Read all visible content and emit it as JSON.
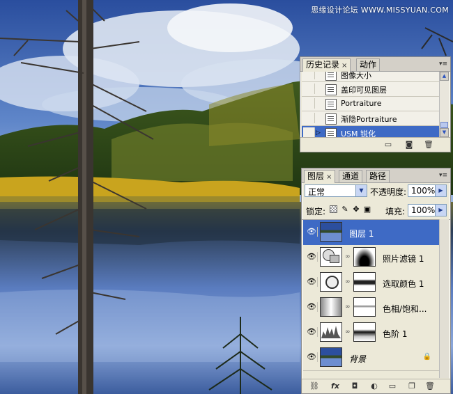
{
  "watermark": "思缘设计论坛 WWW.MISSYUAN.COM",
  "history_panel": {
    "tabs": [
      {
        "label": "历史记录",
        "close": "×",
        "active": true
      },
      {
        "label": "动作",
        "close": "",
        "active": false
      }
    ],
    "menu_icon": "▾≡",
    "items": [
      {
        "label": "图像大小",
        "selected": false,
        "current": false
      },
      {
        "label": "盖印可见图层",
        "selected": false,
        "current": false
      },
      {
        "label": "Portraiture",
        "selected": false,
        "current": false
      },
      {
        "label": "渐隐Portraiture",
        "selected": false,
        "current": false
      },
      {
        "label": "USM 锐化",
        "selected": true,
        "current": true
      }
    ],
    "footer_icons": [
      "new-document-from-state-icon",
      "snapshot-icon",
      "trash-icon"
    ]
  },
  "layers_panel": {
    "tabs": [
      {
        "label": "图层",
        "close": "×",
        "active": true
      },
      {
        "label": "通道",
        "close": "",
        "active": false
      },
      {
        "label": "路径",
        "close": "",
        "active": false
      }
    ],
    "menu_icon": "▾≡",
    "blend_mode": "正常",
    "opacity_label": "不透明度:",
    "opacity_value": "100%",
    "lock_label": "锁定:",
    "fill_label": "填充:",
    "fill_value": "100%",
    "layers": [
      {
        "name": "图层 1",
        "selected": true,
        "type": "pixel",
        "italic": false
      },
      {
        "name": "照片滤镜 1",
        "selected": false,
        "type": "adjustment",
        "italic": false
      },
      {
        "name": "选取颜色 1",
        "selected": false,
        "type": "adjustment",
        "italic": false
      },
      {
        "name": "色相/饱和...",
        "selected": false,
        "type": "adjustment",
        "italic": false
      },
      {
        "name": "色阶 1",
        "selected": false,
        "type": "adjustment",
        "italic": false
      },
      {
        "name": "背景",
        "selected": false,
        "type": "background",
        "italic": true
      }
    ],
    "footer_icons": [
      "link-icon",
      "fx-icon",
      "mask-icon",
      "adjustment-icon",
      "group-folder-icon",
      "new-layer-icon",
      "trash-icon"
    ]
  },
  "colors": {
    "selection": "#3e6ac5",
    "panel_bg": "#ece9d8"
  }
}
